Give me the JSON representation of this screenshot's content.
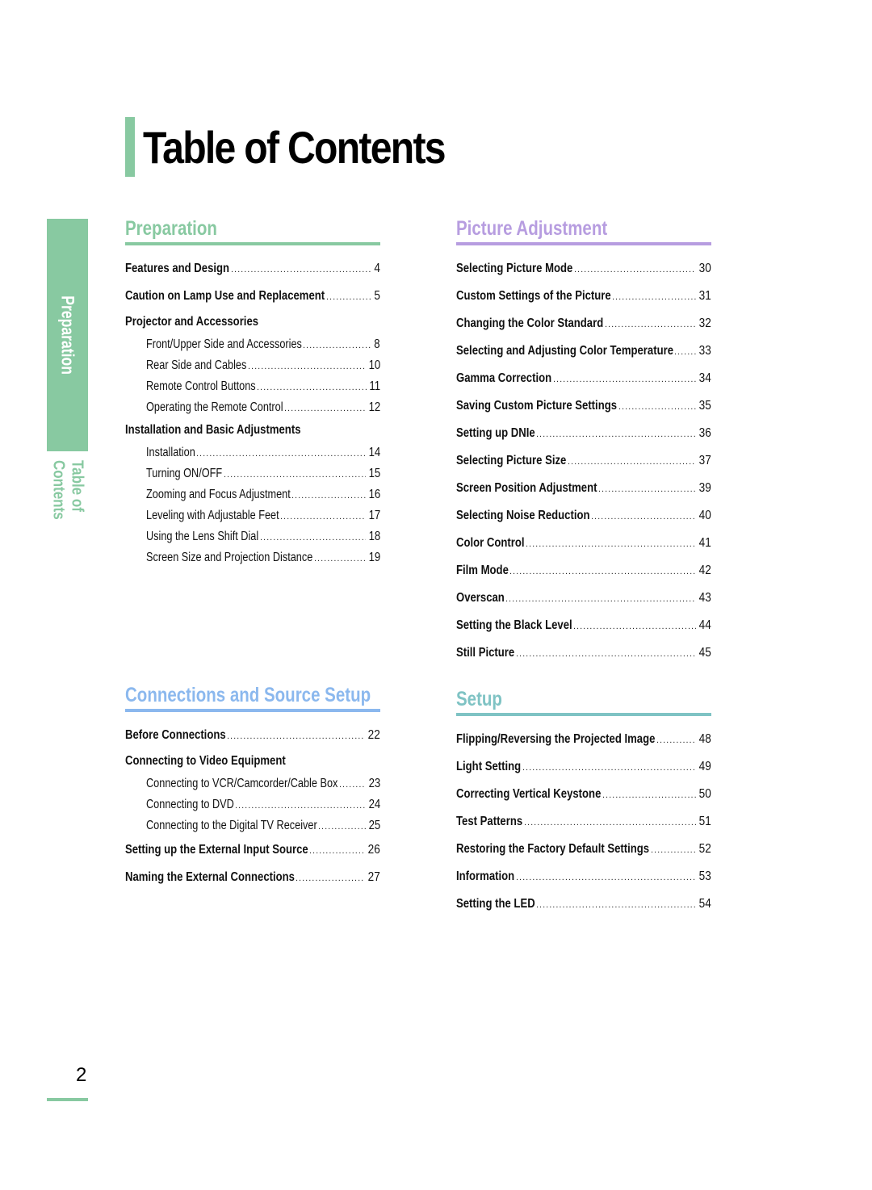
{
  "page": {
    "title": "Table of Contents",
    "side_tab_label": "Preparation",
    "side_sub_label": "Table of Contents",
    "page_number": "2"
  },
  "colors": {
    "preparation": "#88c9a1",
    "connections": "#8bb8ee",
    "picture": "#b79de0",
    "setup": "#7fc3c4"
  },
  "sections": {
    "preparation": {
      "heading": "Preparation",
      "entries": [
        {
          "type": "main",
          "label": "Features and Design",
          "page": "4"
        },
        {
          "type": "main",
          "label": "Caution on Lamp Use and Replacement",
          "page": "5"
        },
        {
          "type": "group",
          "label": "Projector and Accessories"
        },
        {
          "type": "sub",
          "label": "Front/Upper Side and Accessories",
          "page": "8"
        },
        {
          "type": "sub",
          "label": "Rear Side and Cables",
          "page": "10"
        },
        {
          "type": "sub",
          "label": "Remote Control Buttons",
          "page": "11"
        },
        {
          "type": "sub",
          "label": "Operating the Remote Control",
          "page": "12"
        },
        {
          "type": "group",
          "label": "Installation and Basic Adjustments"
        },
        {
          "type": "sub",
          "label": "Installation",
          "page": "14"
        },
        {
          "type": "sub",
          "label": "Turning ON/OFF",
          "page": "15"
        },
        {
          "type": "sub",
          "label": "Zooming and Focus Adjustment",
          "page": "16"
        },
        {
          "type": "sub",
          "label": "Leveling with Adjustable Feet",
          "page": "17"
        },
        {
          "type": "sub",
          "label": "Using the Lens Shift Dial",
          "page": "18"
        },
        {
          "type": "sub",
          "label": "Screen Size and Projection Distance",
          "page": "19"
        }
      ]
    },
    "connections": {
      "heading": "Connections and Source Setup",
      "entries": [
        {
          "type": "main",
          "label": "Before Connections",
          "page": "22"
        },
        {
          "type": "group",
          "label": "Connecting to Video Equipment"
        },
        {
          "type": "sub",
          "label": "Connecting to VCR/Camcorder/Cable Box",
          "page": "23"
        },
        {
          "type": "sub",
          "label": "Connecting to DVD",
          "page": "24"
        },
        {
          "type": "sub",
          "label": "Connecting to the Digital TV Receiver",
          "page": "25"
        },
        {
          "type": "main",
          "label": "Setting up the External Input Source",
          "page": "26"
        },
        {
          "type": "main",
          "label": "Naming the External Connections",
          "page": "27"
        }
      ]
    },
    "picture": {
      "heading": "Picture Adjustment",
      "entries": [
        {
          "type": "main",
          "label": "Selecting Picture Mode",
          "page": "30"
        },
        {
          "type": "main",
          "label": "Custom Settings of the Picture",
          "page": "31"
        },
        {
          "type": "main",
          "label": "Changing the Color Standard",
          "page": "32"
        },
        {
          "type": "main",
          "label": "Selecting and Adjusting Color Temperature",
          "page": "33"
        },
        {
          "type": "main",
          "label": "Gamma Correction",
          "page": "34"
        },
        {
          "type": "main",
          "label": "Saving Custom Picture Settings",
          "page": "35"
        },
        {
          "type": "main",
          "label": "Setting up DNIe",
          "page": "36"
        },
        {
          "type": "main",
          "label": "Selecting Picture Size",
          "page": "37"
        },
        {
          "type": "main",
          "label": "Screen Position Adjustment",
          "page": "39"
        },
        {
          "type": "main",
          "label": "Selecting Noise Reduction",
          "page": "40"
        },
        {
          "type": "main",
          "label": "Color Control",
          "page": "41"
        },
        {
          "type": "main",
          "label": "Film Mode",
          "page": "42"
        },
        {
          "type": "main",
          "label": "Overscan",
          "page": "43"
        },
        {
          "type": "main",
          "label": "Setting the Black Level",
          "page": "44"
        },
        {
          "type": "main",
          "label": "Still Picture",
          "page": "45"
        }
      ]
    },
    "setup": {
      "heading": "Setup",
      "entries": [
        {
          "type": "main",
          "label": "Flipping/Reversing the Projected Image",
          "page": "48"
        },
        {
          "type": "main",
          "label": "Light Setting",
          "page": "49"
        },
        {
          "type": "main",
          "label": "Correcting Vertical Keystone",
          "page": "50"
        },
        {
          "type": "main",
          "label": "Test Patterns",
          "page": "51"
        },
        {
          "type": "main",
          "label": "Restoring the Factory Default Settings",
          "page": "52"
        },
        {
          "type": "main",
          "label": "Information",
          "page": "53"
        },
        {
          "type": "main",
          "label": "Setting the LED",
          "page": "54"
        }
      ]
    }
  }
}
